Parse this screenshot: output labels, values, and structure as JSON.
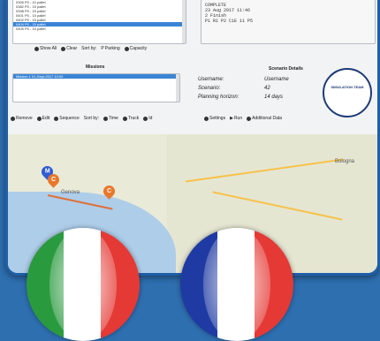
{
  "vehicles": {
    "items": [
      "0306 P0 - 10 pallet",
      "0382 P0 - 15 pallet",
      "0398 P0 - 15 pallet",
      "0401 P0 - 15 pallet",
      "0402 P0 - 15 pallet",
      "0404 P0 - 15 pallet",
      "0405 P0 - 15 pallet"
    ],
    "selected_index": 5,
    "toolbar": [
      "Show All",
      "Clear",
      "Sort by:",
      "Parking",
      "Capacity"
    ]
  },
  "log": {
    "lines": [
      "COMPLETE",
      "23 Aug 2017 11:46",
      "2 Finish",
      "P1 R1 P2 C1E 11 P5"
    ]
  },
  "missions": {
    "title": "Missions",
    "items": [
      "Mission 1  01-Sept-2017 10:00"
    ],
    "toolbar": [
      "Remove",
      "Edit",
      "Sequence",
      "Sort by:",
      "Time",
      "Truck",
      "Id"
    ]
  },
  "scenario": {
    "title": "Scenario Details",
    "rows": [
      {
        "label": "Username:",
        "value": "Username"
      },
      {
        "label": "Scenario:",
        "value": "42"
      },
      {
        "label": "Planning horizon:",
        "value": "14 days"
      }
    ],
    "toolbar": [
      "Settings",
      "Run",
      "Additional Data"
    ],
    "logo_text": "SIMULATION TEAM"
  },
  "map": {
    "cities": [
      "Genova",
      "Bologna"
    ],
    "pins": [
      {
        "label": "M",
        "color": "#2f5bd3"
      },
      {
        "label": "C",
        "color": "#e8782c"
      },
      {
        "label": "C",
        "color": "#e8782c"
      }
    ]
  },
  "flags": {
    "italy": [
      "#2a9a3f",
      "#ffffff",
      "#e53935"
    ],
    "france": [
      "#1f3aa3",
      "#ffffff",
      "#e53935"
    ]
  }
}
